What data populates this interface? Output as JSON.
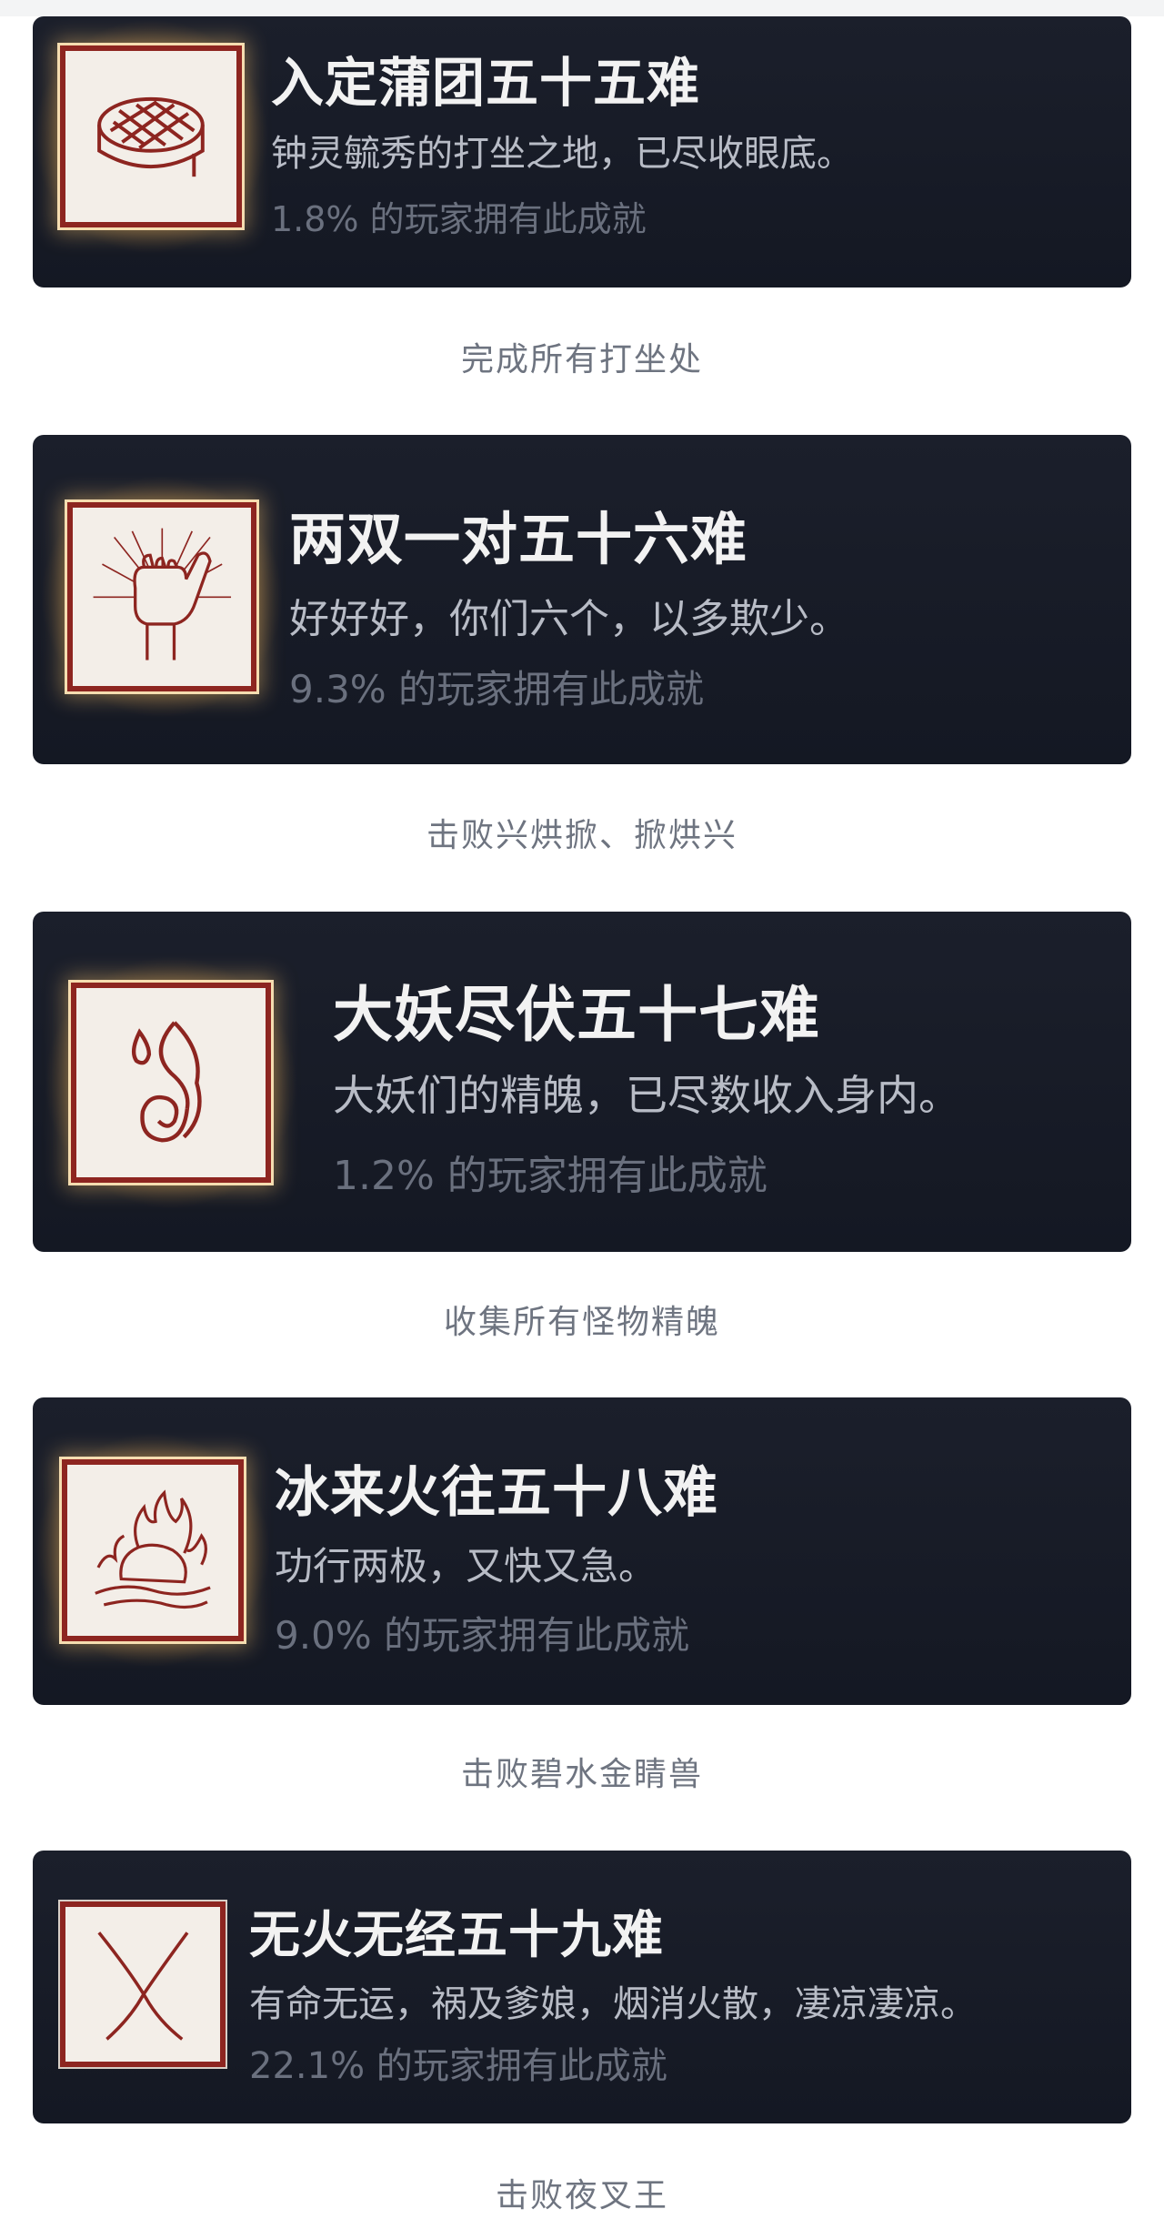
{
  "achievements": [
    {
      "title": "入定蒲团五十五难",
      "description": "钟灵毓秀的打坐之地，已尽收眼底。",
      "percent": "1.8% 的玩家拥有此成就",
      "caption": "完成所有打坐处",
      "icon": "cushion-icon"
    },
    {
      "title": "两双一对五十六难",
      "description": "好好好，你们六个，以多欺少。",
      "percent": "9.3% 的玩家拥有此成就",
      "caption": "击败兴烘掀、掀烘兴",
      "icon": "hand-gesture-icon"
    },
    {
      "title": "大妖尽伏五十七难",
      "description": "大妖们的精魄，已尽数收入身内。",
      "percent": "1.2% 的玩家拥有此成就",
      "caption": "收集所有怪物精魄",
      "icon": "spirit-flame-icon"
    },
    {
      "title": "冰来火往五十八难",
      "description": "功行两极，又快又急。",
      "percent": "9.0% 的玩家拥有此成就",
      "caption": "击败碧水金睛兽",
      "icon": "burning-rock-icon"
    },
    {
      "title": "无火无经五十九难",
      "description": "有命无运，祸及爹娘，烟消火散，凄凉凄凉。",
      "percent": "22.1% 的玩家拥有此成就",
      "caption": "击败夜叉王",
      "icon": "crossed-lines-icon"
    }
  ]
}
